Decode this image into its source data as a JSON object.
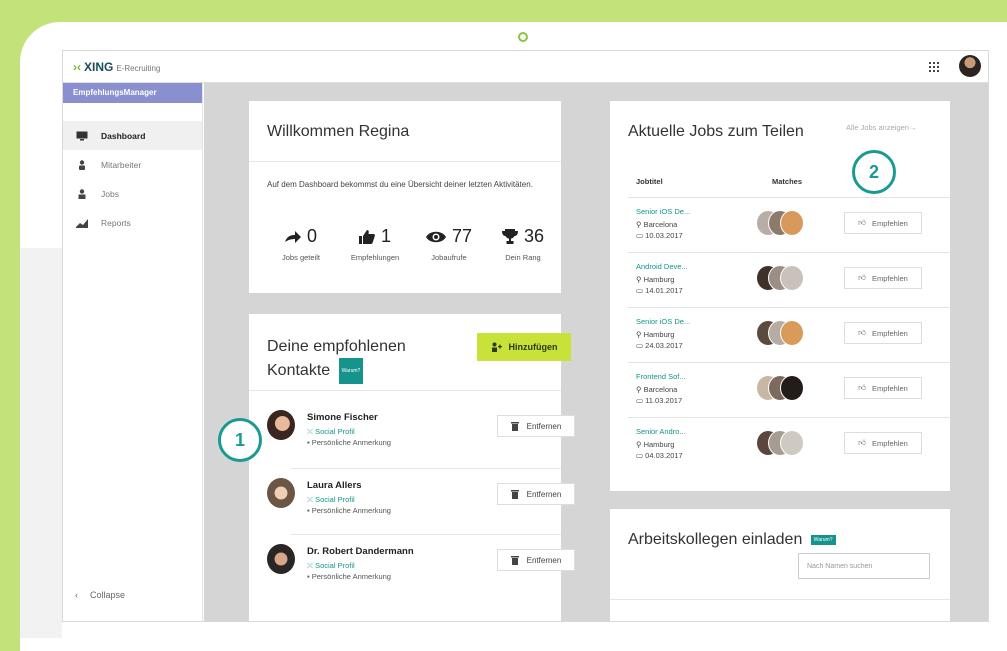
{
  "app": {
    "logo_brand": "XING",
    "logo_sub": "E-Recruiting"
  },
  "sidebar": {
    "header": "EmpfehlungsManager",
    "items": [
      {
        "label": "Dashboard",
        "icon": "monitor-icon",
        "active": true
      },
      {
        "label": "Mitarbeiter",
        "icon": "person-icon",
        "active": false
      },
      {
        "label": "Jobs",
        "icon": "briefcase-icon",
        "active": false
      },
      {
        "label": "Reports",
        "icon": "chart-icon",
        "active": false
      }
    ],
    "collapse_label": "Collapse"
  },
  "welcome": {
    "title": "Willkommen Regina",
    "text": "Auf dem Dashboard bekommst du eine Übersicht deiner letzten Aktivitäten.",
    "stats": [
      {
        "value": "0",
        "label": "Jobs geteilt",
        "icon": "share-arrow-icon"
      },
      {
        "value": "1",
        "label": "Empfehlungen",
        "icon": "thumbs-up-icon"
      },
      {
        "value": "77",
        "label": "Jobaufrufe",
        "icon": "eye-icon"
      },
      {
        "value": "36",
        "label": "Dein Rang",
        "icon": "trophy-icon"
      }
    ]
  },
  "contacts": {
    "title_line1": "Deine empfohlenen",
    "title_line2": "Kontakte",
    "badge": "Warum?",
    "add_label": "Hinzufügen",
    "items": [
      {
        "name": "Simone Fischer",
        "social": "Social Profil",
        "note": "Persönliche Anmerkung",
        "remove": "Entfernen"
      },
      {
        "name": "Laura Allers",
        "social": "Social Profil",
        "note": "Persönliche Anmerkung",
        "remove": "Entfernen"
      },
      {
        "name": "Dr. Robert Dandermann",
        "social": "Social Profil",
        "note": "Persönliche Anmerkung",
        "remove": "Entfernen"
      }
    ]
  },
  "jobs": {
    "title": "Aktuelle Jobs zum Teilen",
    "all_link": "Alle Jobs anzeigen→",
    "col_title": "Jobtitel",
    "col_matches": "Matches",
    "items": [
      {
        "title": "Senior iOS De...",
        "city": "Barcelona",
        "date": "10.03.2017",
        "action": "Empfehlen"
      },
      {
        "title": "Android Deve...",
        "city": "Hamburg",
        "date": "14.01.2017",
        "action": "Empfehlen"
      },
      {
        "title": "Senior iOS De...",
        "city": "Hamburg",
        "date": "24.03.2017",
        "action": "Empfehlen"
      },
      {
        "title": "Frontend Sof...",
        "city": "Barcelona",
        "date": "11.03.2017",
        "action": "Empfehlen"
      },
      {
        "title": "Senior Andro...",
        "city": "Hamburg",
        "date": "04.03.2017",
        "action": "Empfehlen"
      }
    ]
  },
  "invite": {
    "title": "Arbeitskollegen einladen",
    "badge": "Warum?",
    "search_placeholder": "Nach Namen suchen"
  },
  "callouts": {
    "one": "1",
    "two": "2"
  },
  "colors": {
    "frame_green": "#c3e27a",
    "accent_teal": "#14948c",
    "add_button": "#c8e23a",
    "sidebar_header": "#8a8fd0"
  }
}
